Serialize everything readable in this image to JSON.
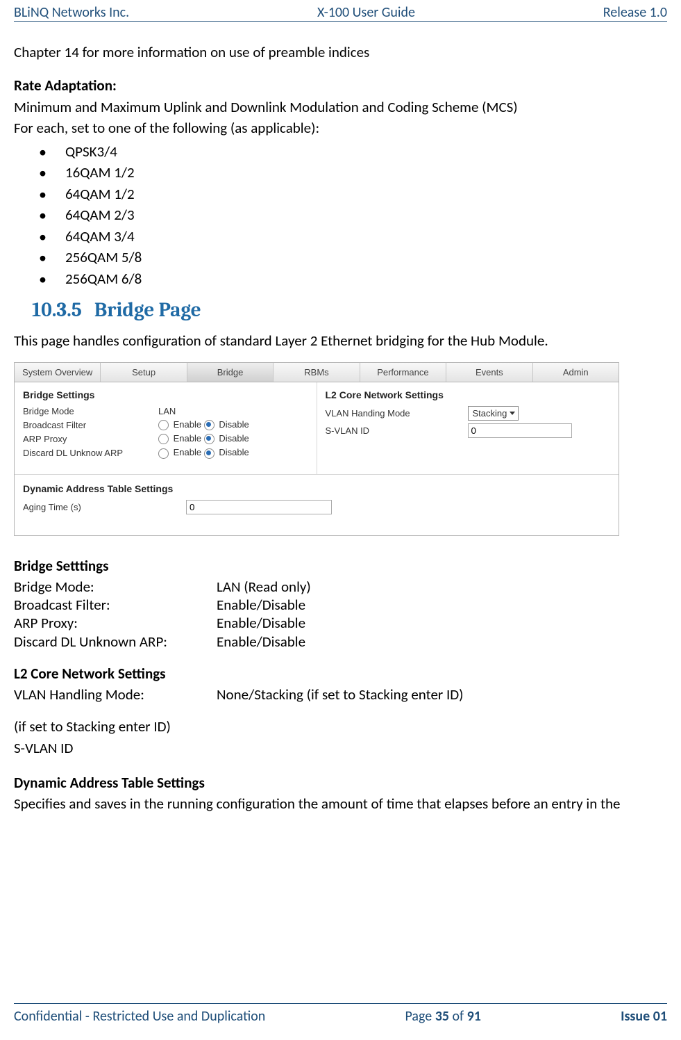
{
  "header": {
    "left": "BLiNQ Networks Inc.",
    "center": "X-100 User Guide",
    "right": "Release 1.0"
  },
  "footer": {
    "left": "Confidential - Restricted Use and Duplication",
    "mid_pre": "Page ",
    "mid_b": "35",
    "mid_mid": " of ",
    "mid_b2": "91",
    "right": "Issue 01"
  },
  "intro_line": "Chapter 14 for more information on use of preamble indices",
  "rate": {
    "title": "Rate Adaptation:",
    "line1": "Minimum and Maximum Uplink and Downlink Modulation and Coding Scheme (MCS)",
    "line2": "For each, set to one of the following (as applicable):",
    "items": [
      "QPSK3/4",
      "16QAM 1/2",
      "64QAM 1/2",
      "64QAM 2/3",
      "64QAM 3/4",
      "256QAM 5/8",
      "256QAM 6/8"
    ]
  },
  "section": {
    "num": "10.3.5",
    "title": "Bridge Page"
  },
  "section_desc": "This page handles configuration of standard Layer 2 Ethernet bridging for the Hub Module.",
  "shot": {
    "tabs": [
      "System Overview",
      "Setup",
      "Bridge",
      "RBMs",
      "Performance",
      "Events",
      "Admin"
    ],
    "active_tab": 2,
    "left_panel": {
      "title": "Bridge Settings",
      "rows": [
        {
          "label": "Bridge Mode",
          "text": "LAN"
        },
        {
          "label": "Broadcast Filter",
          "en": "Enable",
          "dis": "Disable",
          "checked": "dis"
        },
        {
          "label": "ARP Proxy",
          "en": "Enable",
          "dis": "Disable",
          "checked": "dis"
        },
        {
          "label": "Discard DL Unknow ARP",
          "en": "Enable",
          "dis": "Disable",
          "checked": "dis"
        }
      ]
    },
    "right_panel": {
      "title": "L2 Core Network Settings",
      "vlan_label": "VLAN Handing Mode",
      "vlan_value": "Stacking",
      "svlan_label": "S-VLAN ID",
      "svlan_value": "0"
    },
    "dyn": {
      "title": "Dynamic Address Table Settings",
      "aging_label": "Aging Time (s)",
      "aging_value": "0"
    }
  },
  "defs": {
    "bs_title": "Bridge Setttings",
    "rows": [
      {
        "k": "Bridge Mode:",
        "v": "LAN (Read only)"
      },
      {
        "k": "Broadcast Filter:",
        "v": "Enable/Disable"
      },
      {
        "k": "ARP Proxy:",
        "v": "Enable/Disable"
      },
      {
        "k": "Discard DL Unknown ARP:",
        "v": "Enable/Disable"
      }
    ],
    "l2_title": "L2 Core Network Settings",
    "l2_row_k": "VLAN Handling Mode:",
    "l2_row_v": "None/Stacking (if set to Stacking enter ID)",
    "cond": " (if set to Stacking enter ID)",
    "svlan": "S-VLAN ID",
    "dyn_title": "Dynamic Address Table Settings",
    "dyn_desc": "Specifies and saves in the running configuration the amount of time that elapses before an entry in the"
  }
}
